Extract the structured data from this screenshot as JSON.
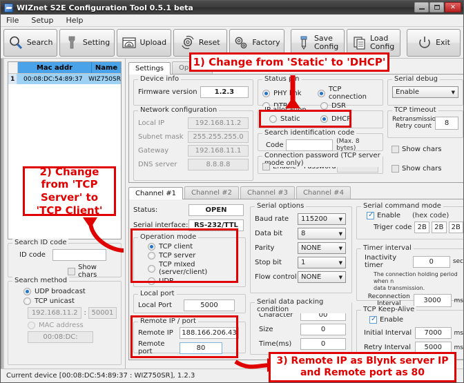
{
  "window": {
    "title": "WIZnet S2E Configuration Tool 0.5.1 beta",
    "minimize": "—",
    "maximize": "□",
    "close": "✕"
  },
  "menu": {
    "items": [
      "File",
      "Setup",
      "Help"
    ]
  },
  "toolbar": {
    "buttons": [
      {
        "label": "Search",
        "icon": "magnifier-icon"
      },
      {
        "label": "Setting",
        "icon": "wrench-icon"
      },
      {
        "label": "Upload",
        "icon": "upload-window-icon"
      },
      {
        "label": "Reset",
        "icon": "gear-refresh-icon"
      },
      {
        "label": "Factory",
        "icon": "gears-icon"
      },
      {
        "label_line1": "Save",
        "label_line2": "Config",
        "icon": "save-icon"
      },
      {
        "label_line1": "Load",
        "label_line2": "Config",
        "icon": "load-icon"
      },
      {
        "label": "Exit",
        "icon": "power-icon"
      }
    ]
  },
  "device_list": {
    "columns": [
      "",
      "Mac addr",
      "Name"
    ],
    "rows": [
      {
        "index": "1",
        "mac": "00:08:DC:54:89:37",
        "name": "WIZ750SR"
      }
    ]
  },
  "search_id_code": {
    "title": "Search ID code",
    "id_code_label": "ID code",
    "id_code_value": "",
    "show_chars_label": "Show chars",
    "show_chars_checked": false
  },
  "search_method": {
    "title": "Search method",
    "options": [
      {
        "label": "UDP broadcast",
        "selected": true,
        "disabled": false
      },
      {
        "label": "TCP unicast",
        "selected": false,
        "disabled": false
      },
      {
        "label": "MAC address",
        "selected": false,
        "disabled": true
      }
    ],
    "unicast_ip": "192.168.11.2",
    "unicast_sep": ":",
    "unicast_port": "50001",
    "mac_prefix": "00:08:DC:"
  },
  "tabs": {
    "main": [
      {
        "label": "Settings",
        "active": true
      },
      {
        "label": "Options",
        "active": false
      }
    ],
    "channels": [
      {
        "label": "Channel #1",
        "active": true
      },
      {
        "label": "Channel #2",
        "active": false
      },
      {
        "label": "Channel #3",
        "active": false
      },
      {
        "label": "Channel #4",
        "active": false
      }
    ]
  },
  "device_info": {
    "title": "Device info",
    "firmware_label": "Firmware version",
    "firmware_value": "1.2.3"
  },
  "network_config": {
    "title": "Network configuration",
    "rows": [
      {
        "label": "Local IP",
        "value": "192.168.11.2"
      },
      {
        "label": "Subnet mask",
        "value": "255.255.255.0"
      },
      {
        "label": "Gateway",
        "value": "192.168.11.1"
      },
      {
        "label": "DNS server",
        "value": "8.8.8.8"
      }
    ]
  },
  "status_pin": {
    "title": "Status pin",
    "options": [
      {
        "label": "PHY link",
        "selected": true
      },
      {
        "label": "TCP connection",
        "selected": true
      },
      {
        "label": "DTR",
        "selected": false
      },
      {
        "label": "DSR",
        "selected": false
      }
    ]
  },
  "ip_allocation": {
    "title": "IP allocation",
    "options": [
      {
        "label": "Static",
        "selected": false
      },
      {
        "label": "DHCP",
        "selected": true
      }
    ]
  },
  "search_identification_code": {
    "title": "Search identification code",
    "code_label": "Code",
    "code_value": "",
    "hint": "(Max. 8 bytes)",
    "show_chars_label": "Show chars",
    "show_chars_checked": false
  },
  "connection_password": {
    "title": "Connection password (TCP server mode only)",
    "enable_label": "Enable",
    "enable_checked": false,
    "password_label": "Password",
    "password_value": "",
    "show_chars_label": "Show chars",
    "show_chars_checked": false
  },
  "serial_debug": {
    "title": "Serial debug",
    "value": "Enable"
  },
  "tcp_timeout": {
    "title": "TCP timeout",
    "label_line1": "Retransmission",
    "label_line2": "Retry count",
    "value": "8"
  },
  "channel_status": {
    "status_label": "Status:",
    "status_value": "OPEN",
    "serial_interface_label": "Serial interface:",
    "serial_interface_value": "RS-232/TTL"
  },
  "operation_mode": {
    "title": "Operation mode",
    "options": [
      {
        "label": "TCP client",
        "selected": true
      },
      {
        "label": "TCP server",
        "selected": false
      },
      {
        "label": "TCP mIxed (server/client)",
        "selected": false
      },
      {
        "label": "UDP",
        "selected": false
      }
    ]
  },
  "local_port": {
    "title": "Local port",
    "label": "Local Port",
    "value": "5000"
  },
  "remote_ip_port": {
    "title": "Remote IP / port",
    "ip_label": "Remote IP",
    "ip_value": "188.166.206.43",
    "port_label": "Remote port",
    "port_value": "80"
  },
  "serial_options": {
    "title": "Serial options",
    "rows": [
      {
        "label": "Baud rate",
        "value": "115200"
      },
      {
        "label": "Data bit",
        "value": "8"
      },
      {
        "label": "Parity",
        "value": "NONE"
      },
      {
        "label": "Stop bit",
        "value": "1"
      },
      {
        "label": "Flow control",
        "value": "NONE"
      }
    ]
  },
  "serial_packing": {
    "title": "Serial data packing condition",
    "rows": [
      {
        "label": "Character",
        "value": "00"
      },
      {
        "label": "Size",
        "value": "0"
      },
      {
        "label": "Time(ms)",
        "value": "0"
      }
    ]
  },
  "serial_command_mode": {
    "title": "Serial command mode",
    "enable_label": "Enable",
    "enable_checked": true,
    "hex_hint": "(hex code)",
    "trigger_label": "Triger code",
    "trigger_values": [
      "2B",
      "2B",
      "2B"
    ]
  },
  "timer_interval": {
    "title": "Timer interval",
    "inactivity_label": "Inactivity timer",
    "inactivity_value": "0",
    "inactivity_unit": "sec",
    "note_line1": "The connection holding period when n",
    "note_line2": "data transmission.",
    "reconnection_label_line1": "Reconnection",
    "reconnection_label_line2": "Interval",
    "reconnection_value": "3000",
    "reconnection_unit": "ms"
  },
  "tcp_keepalive": {
    "title": "TCP Keep-Alive",
    "enable_label": "Enable",
    "enable_checked": true,
    "rows": [
      {
        "label": "Initial Interval",
        "value": "7000",
        "unit": "ms"
      },
      {
        "label": "Retry Interval",
        "value": "5000",
        "unit": "ms"
      }
    ]
  },
  "statusbar": {
    "text": "Current device [00:08:DC:54:89:37 : WIZ750SR], 1.2.3"
  },
  "annotations": [
    {
      "id": "a1",
      "text": "1) Change from 'Static' to 'DHCP'"
    },
    {
      "id": "a2",
      "text": "2) Change from 'TCP Server' to 'TCP Client'"
    },
    {
      "id": "a3",
      "text": "3) Remote IP as Blynk server IP and Remote port as 80"
    }
  ],
  "colors": {
    "annotation_red": "#e00000",
    "header_blue": "#4aa3e8",
    "row_blue": "#9ed2f5"
  }
}
